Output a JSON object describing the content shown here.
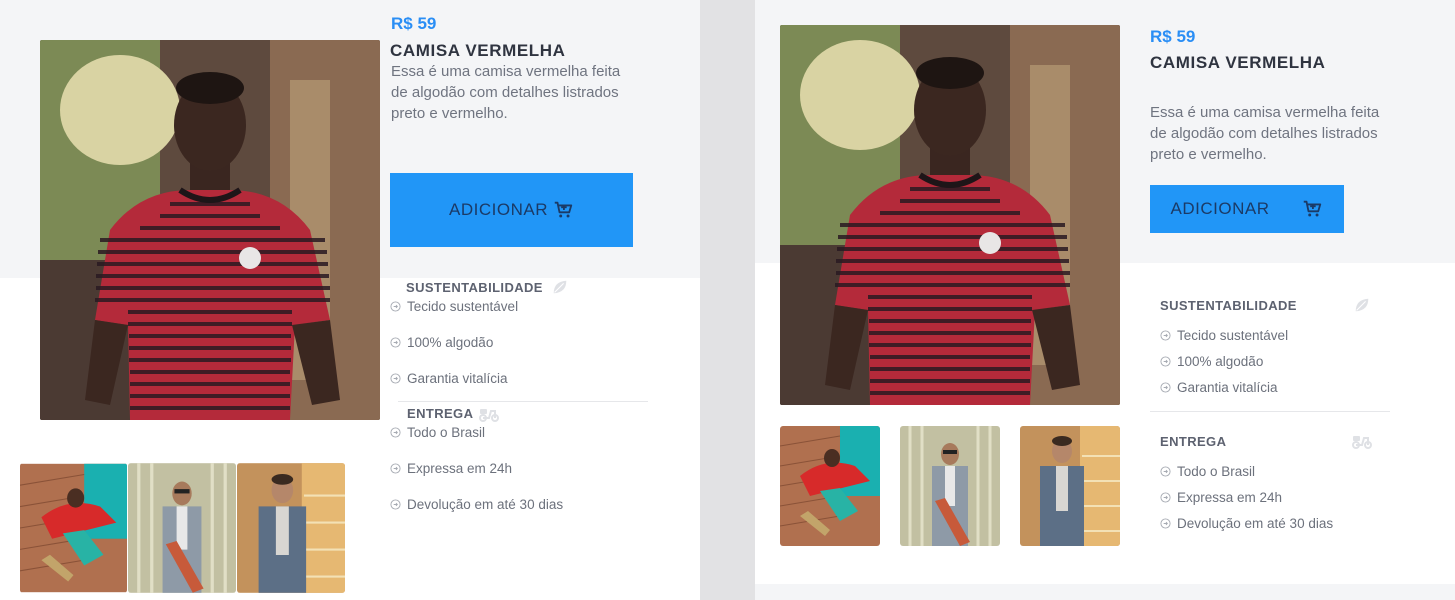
{
  "product": {
    "price": "R$ 59",
    "title": "CAMISA VERMELHA",
    "description": "Essa é uma camisa vermelha feita de algodão com detalhes listrados preto e vermelho.",
    "add_button_label": "ADICIONAR"
  },
  "sustainability": {
    "title": "SUSTENTABILIDADE",
    "icon": "leaf-icon",
    "items": [
      "Tecido sustentável",
      "100% algodão",
      "Garantia vitalícia"
    ]
  },
  "delivery": {
    "title": "ENTREGA",
    "icon": "scooter-icon",
    "items": [
      "Todo o Brasil",
      "Expressa em 24h",
      "Devolução em até 30 dias"
    ]
  },
  "thumbnails": [
    {
      "alt": "red-hoodie-skater-thumbnail"
    },
    {
      "alt": "denim-jacket-skateboard-thumbnail"
    },
    {
      "alt": "denim-jacket-sunset-thumbnail"
    }
  ],
  "colors": {
    "accent": "#2196f7",
    "price": "#2a8ef5",
    "band": "#f4f5f7",
    "divider": "#e2e2e4"
  }
}
